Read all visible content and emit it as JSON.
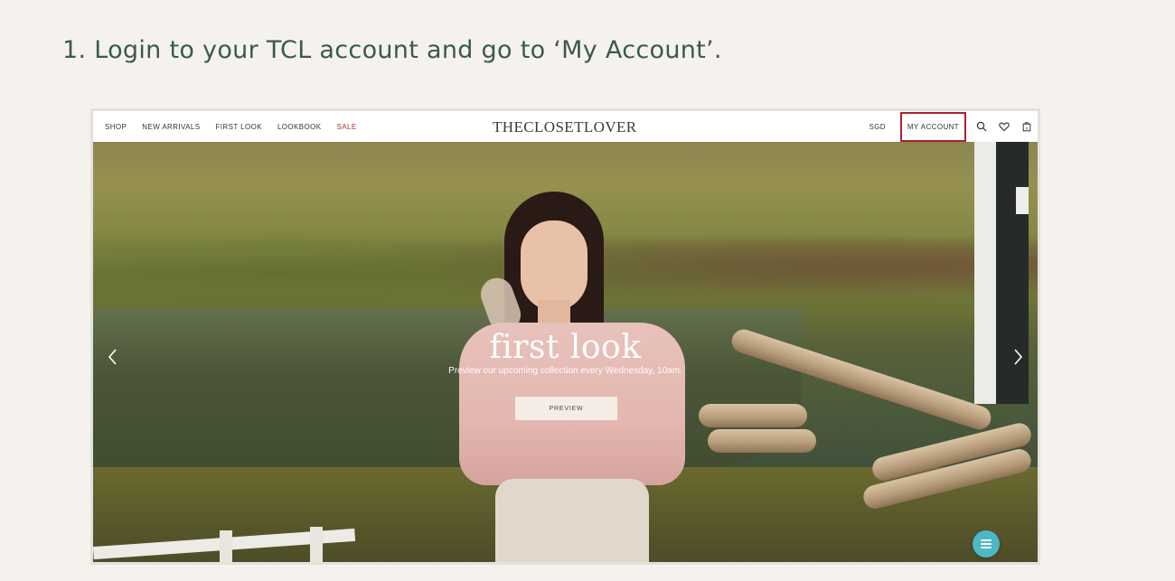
{
  "instruction": {
    "text": "1. Login to your TCL account and go to ‘My Account’."
  },
  "navbar": {
    "links": [
      "SHOP",
      "NEW ARRIVALS",
      "FIRST LOOK",
      "LOOKBOOK",
      "SALE"
    ],
    "logo": "THECLOSETLOVER",
    "currency": "SGD",
    "account": "MY ACCOUNT",
    "icons": [
      "search-icon",
      "heart-icon",
      "bag-icon"
    ],
    "bag_count": "0",
    "highlight_color": "#a8232a",
    "sale_color": "#b7332d"
  },
  "hero": {
    "title": "first look",
    "subtitle": "Preview our upcoming collection every Wednesday, 10am.",
    "button": "PREVIEW"
  },
  "controls": {
    "prev_icon": "chevron-left-icon",
    "next_icon": "chevron-right-icon",
    "chat_icon": "menu-icon",
    "chat_color": "#4eb7c6"
  }
}
